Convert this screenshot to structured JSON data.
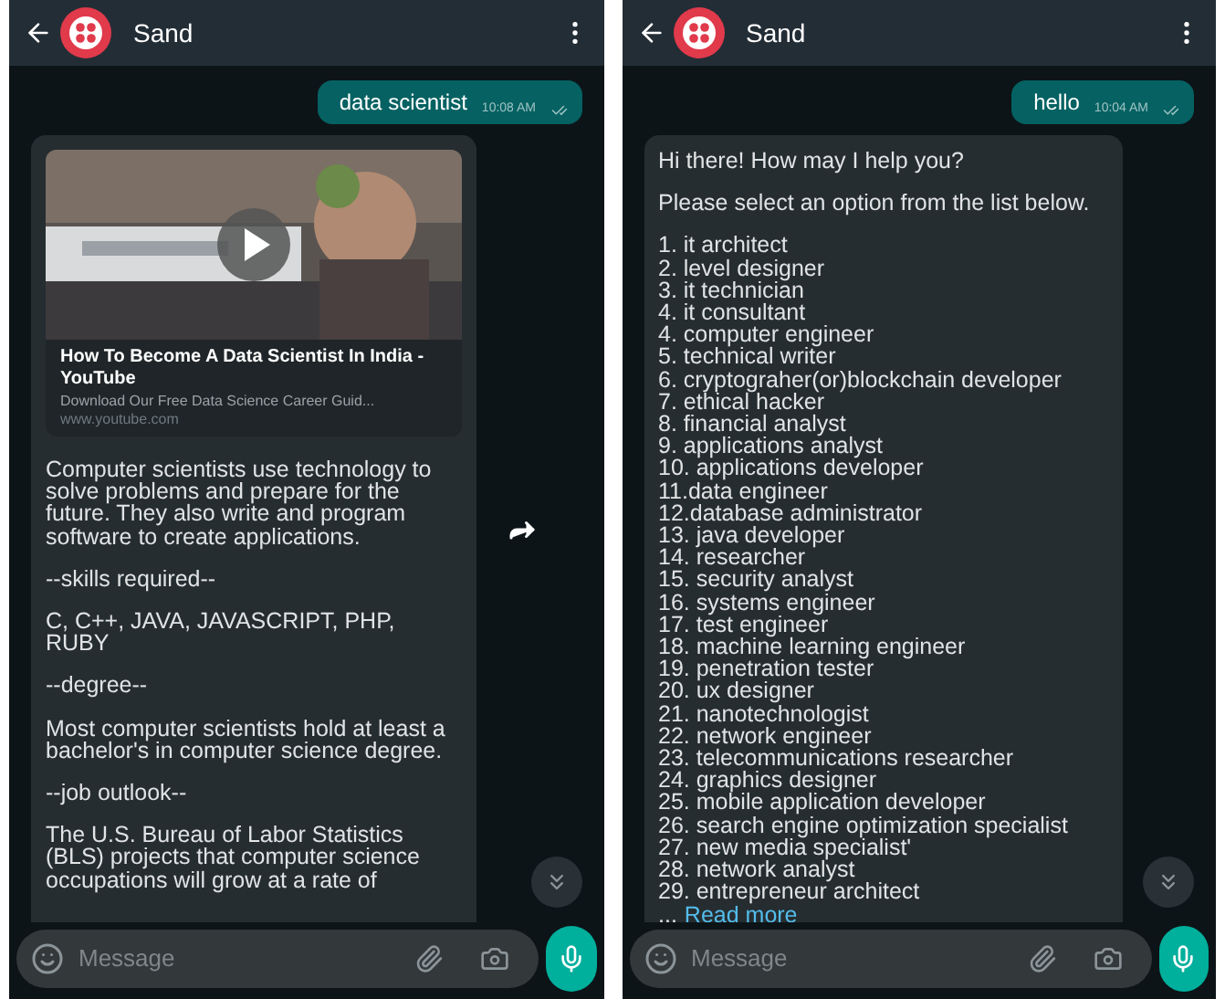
{
  "phones": [
    {
      "header": {
        "title": "Sand"
      },
      "sent": {
        "text": "data scientist",
        "time": "10:08 AM",
        "read": true
      },
      "received": {
        "preview": {
          "kind": "picture",
          "title": "How To Become A Data Scientist In India - YouTube",
          "description": "Download Our Free Data Science Career Guid...",
          "domain": "www.youtube.com"
        },
        "paragraphs": [
          "Computer scientists use technology to solve problems and prepare for the future. They also write and program software to create applications.",
          "--skills required--",
          "C, C++, JAVA, JAVASCRIPT, PHP, RUBY",
          "--degree--",
          "Most computer scientists hold at least a bachelor's in computer science degree.",
          "--job outlook--",
          "The U.S. Bureau of Labor Statistics (BLS) projects that computer science occupations will grow at a rate of"
        ],
        "forward": true
      },
      "input": {
        "placeholder": "Message"
      }
    },
    {
      "header": {
        "title": "Sand"
      },
      "sent": {
        "text": "hello",
        "time": "10:04 AM",
        "read": true
      },
      "received": {
        "paragraphs": [
          "Hi there! How may I help you?",
          "Please select an option from the list below."
        ],
        "lines": [
          "1. it architect",
          "2. level designer",
          "3. it technician",
          "4. it consultant",
          "4. computer engineer",
          "5. technical writer",
          "6. cryptograher(or)blockchain developer",
          "7. ethical hacker",
          "8. financial analyst",
          "9. applications analyst",
          "10. applications developer",
          "11.data engineer",
          "12.database administrator",
          "13. java developer",
          "14. researcher",
          "15. security analyst",
          "16. systems engineer",
          "17. test engineer",
          "18. machine learning engineer",
          "19. penetration tester",
          "20. ux designer",
          "21. nanotechnologist",
          "22. network engineer",
          "23. telecommunications researcher",
          "24. graphics designer",
          "25. mobile application developer",
          "26. search engine optimization specialist",
          "27. new media specialist'",
          "28. network analyst",
          "29. entrepreneur architect"
        ],
        "read_more": {
          "prefix": "...",
          "link": "Read more"
        }
      },
      "input": {
        "placeholder": "Message"
      }
    }
  ]
}
